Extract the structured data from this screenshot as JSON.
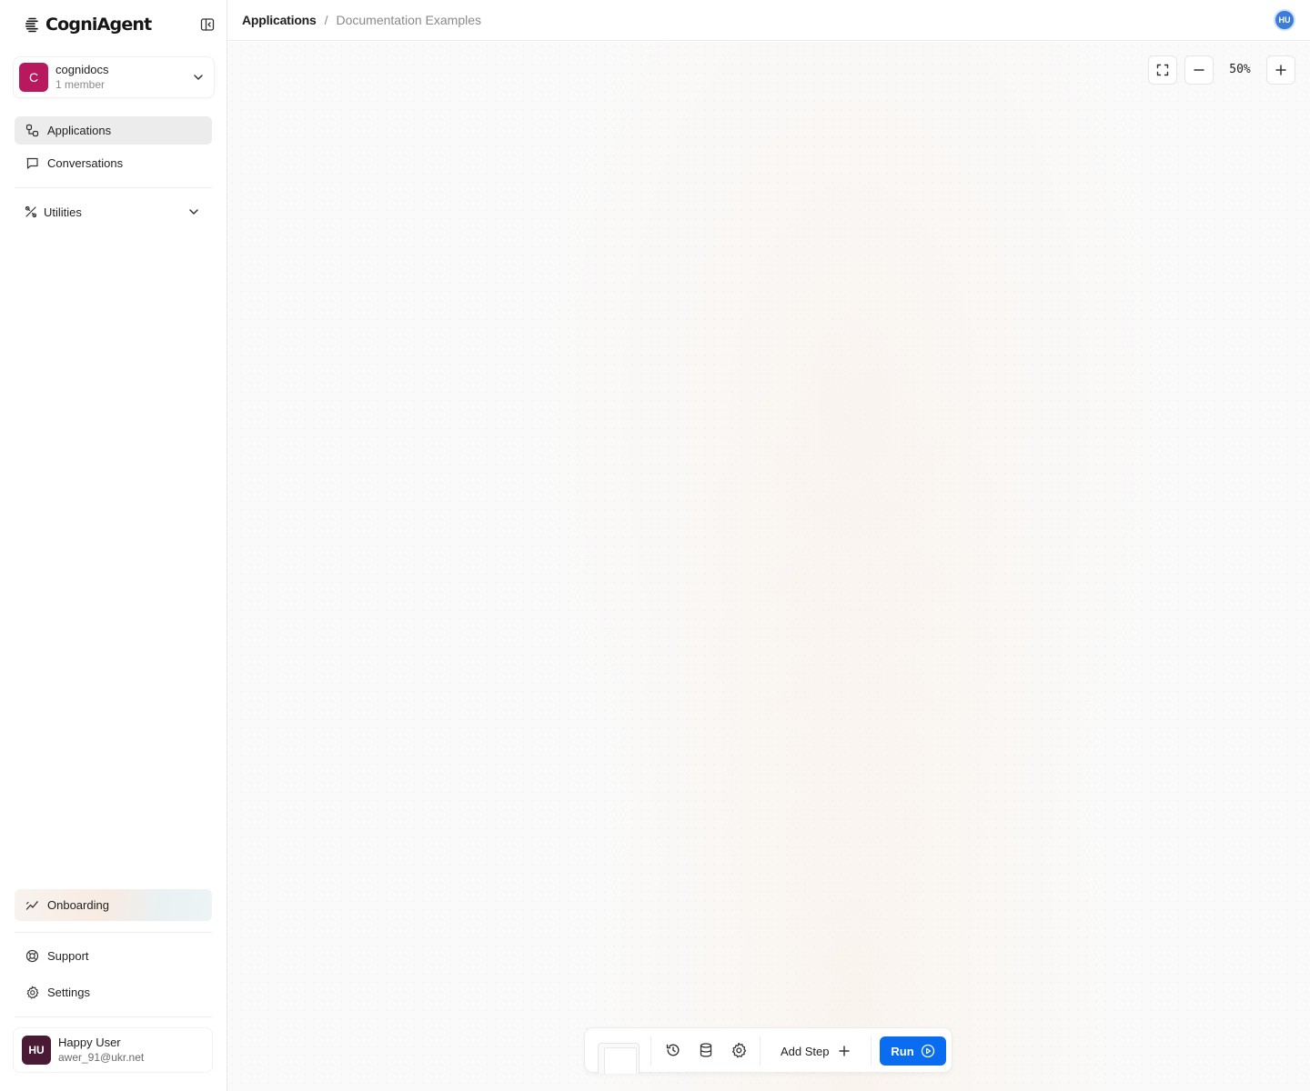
{
  "app": {
    "name": "CogniAgent"
  },
  "workspace": {
    "initial": "C",
    "name": "cognidocs",
    "members": "1 member"
  },
  "nav": {
    "applications": "Applications",
    "conversations": "Conversations",
    "utilities": "Utilities",
    "onboarding": "Onboarding",
    "support": "Support",
    "settings": "Settings"
  },
  "user": {
    "initials": "HU",
    "name": "Happy User",
    "email": "awer_91@ukr.net"
  },
  "breadcrumb": {
    "root": "Applications",
    "separator": "/",
    "current": "Documentation Examples"
  },
  "header": {
    "avatar_initials": "HU"
  },
  "canvas": {
    "zoom": "50%"
  },
  "toolbar": {
    "add_step": "Add Step",
    "run": "Run"
  },
  "colors": {
    "accent": "#0a6cf0",
    "workspace_avatar": "#b8185d",
    "user_avatar": "#4a1a34",
    "header_avatar": "#3b7dd8"
  },
  "icons": {
    "collapse": "sidebar-collapse-icon",
    "applications": "applications-icon",
    "conversations": "chat-bubble-icon",
    "utilities": "tools-icon",
    "onboarding": "trend-icon",
    "support": "lifebuoy-icon",
    "settings": "gear-icon",
    "fit": "fit-screen-icon",
    "zoom_out": "minus-icon",
    "zoom_in": "plus-icon",
    "history": "history-icon",
    "database": "database-icon",
    "run": "play-circle-icon"
  }
}
